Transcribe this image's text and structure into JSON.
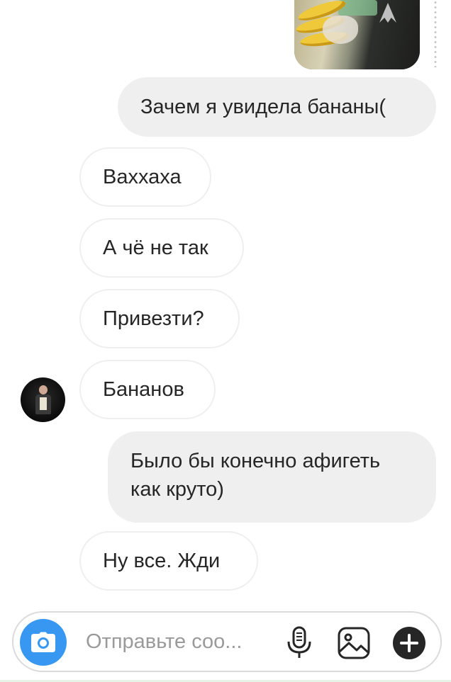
{
  "messages": [
    {
      "direction": "outgoing",
      "text": "Зачем я увидела бананы("
    },
    {
      "direction": "incoming",
      "text": "Ваххаха"
    },
    {
      "direction": "incoming",
      "text": "А чё не так"
    },
    {
      "direction": "incoming",
      "text": "Привезти?"
    },
    {
      "direction": "incoming",
      "text": "Бананов"
    },
    {
      "direction": "outgoing",
      "text": "Было бы конечно афигеть как круто)"
    },
    {
      "direction": "incoming",
      "text": "Ну все. Жди"
    }
  ],
  "composer": {
    "placeholder": "Отправьте соо...",
    "value": ""
  },
  "icons": {
    "camera": "camera-icon",
    "microphone": "microphone-icon",
    "gallery": "gallery-icon",
    "plus": "plus-icon"
  },
  "colors": {
    "accent": "#3897f0",
    "outgoing_bubble": "#efefef",
    "incoming_border": "#efefef",
    "text": "#262626",
    "placeholder": "#9a9a9a"
  }
}
